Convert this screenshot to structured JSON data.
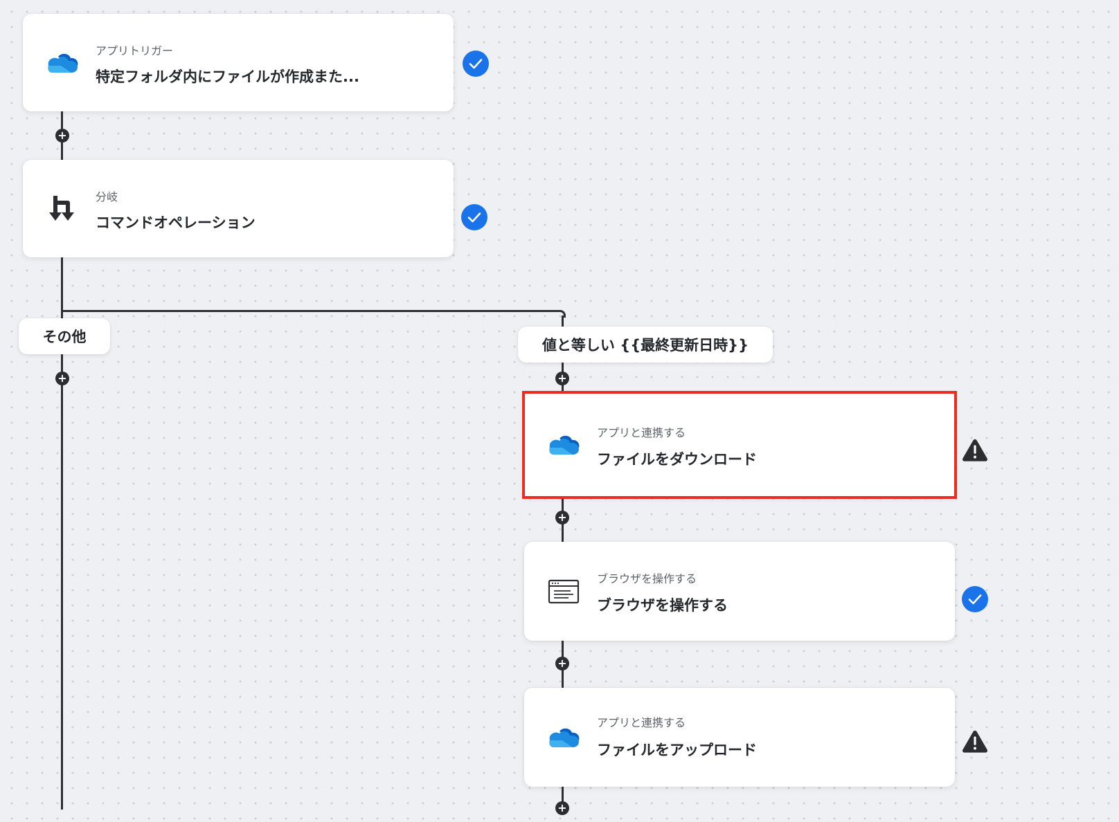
{
  "steps": [
    {
      "subtitle": "アプリトリガー",
      "title": "特定フォルダ内にファイルが作成また...",
      "icon": "onedrive-cloud-icon",
      "status": "check"
    },
    {
      "subtitle": "分岐",
      "title": "コマンドオペレーション",
      "icon": "branch-icon",
      "status": "check"
    },
    {
      "subtitle": "アプリと連携する",
      "title": "ファイルをダウンロード",
      "icon": "onedrive-cloud-icon",
      "status": "warning"
    },
    {
      "subtitle": "ブラウザを操作する",
      "title": "ブラウザを操作する",
      "icon": "browser-window-icon",
      "status": "check"
    },
    {
      "subtitle": "アプリと連携する",
      "title": "ファイルをアップロード",
      "icon": "onedrive-cloud-icon",
      "status": "warning"
    }
  ],
  "branches": {
    "other_label": "その他",
    "condition_label": "値と等しい {{最終更新日時}}"
  },
  "add_symbol": "+",
  "colors": {
    "check": "#1a73e8",
    "warning": "#2b2d31",
    "selection": "#ec2b1c",
    "connector": "#2b2d31"
  }
}
